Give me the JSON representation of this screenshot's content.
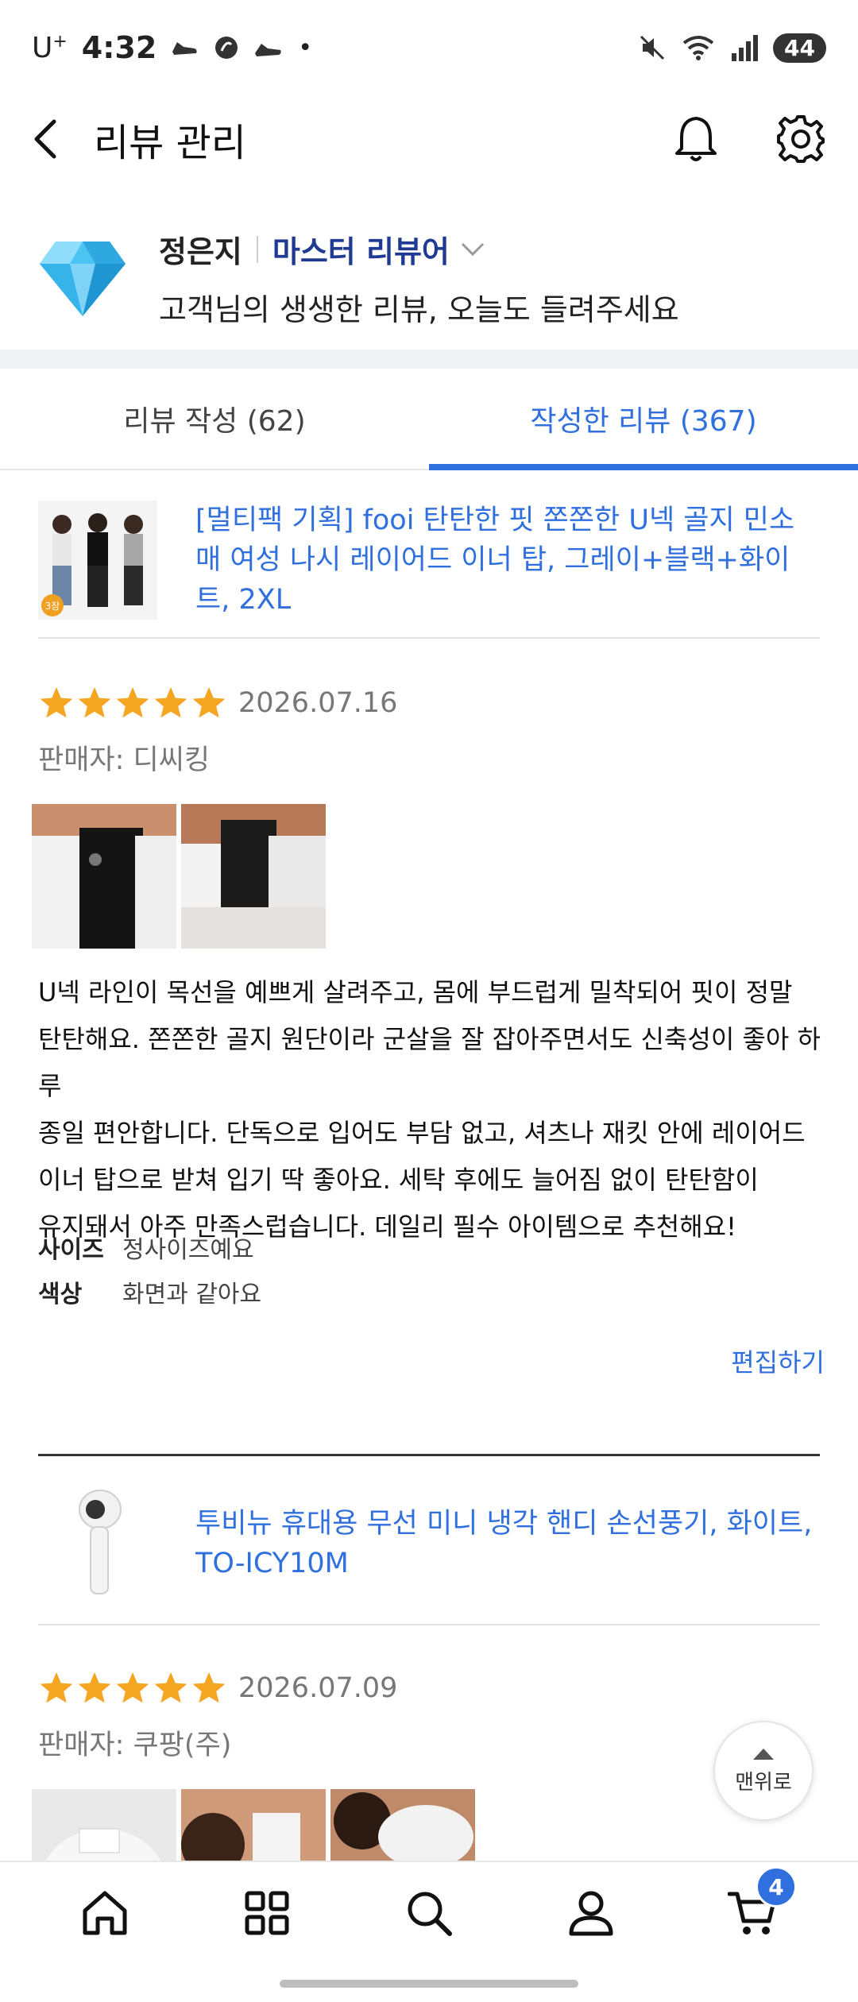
{
  "status_bar": {
    "carrier": "U",
    "carrier_sup": "+",
    "time": "4:32",
    "battery": "44"
  },
  "header": {
    "title": "리뷰 관리"
  },
  "profile": {
    "name": "정은지",
    "rank": "마스터 리뷰어",
    "subtitle": "고객님의 생생한 리뷰, 오늘도 들려주세요"
  },
  "tabs": [
    {
      "label": "리뷰 작성 (62)",
      "active": false
    },
    {
      "label": "작성한 리뷰 (367)",
      "active": true
    }
  ],
  "reviews": [
    {
      "product_name": "[멀티팩 기획] fooi 탄탄한 핏 쫀쫀한 U넥 골지 민소매 여성 나시 레이어드 이너 탑, 그레이+블랙+화이트, 2XL",
      "thumb_badge": "3장",
      "rating": 5,
      "date": "2026.07.16",
      "seller": "판매자: 디씨킹",
      "text_lines": [
        "U넥 라인이 목선을 예쁘게 살려주고, 몸에 부드럽게 밀착되어 핏이 정말",
        "탄탄해요. 쫀쫀한 골지 원단이라 군살을 잘 잡아주면서도 신축성이 좋아 하루",
        "종일 편안합니다. 단독으로 입어도 부담 없고, 셔츠나 재킷 안에 레이어드",
        "이너 탑으로 받쳐 입기 딱 좋아요. 세탁 후에도 늘어짐 없이 탄탄함이",
        "유지돼서 아주 만족스럽습니다. 데일리 필수 아이템으로 추천해요!"
      ],
      "meta": [
        {
          "label": "사이즈",
          "value": "정사이즈예요"
        },
        {
          "label": "색상",
          "value": "화면과 같아요"
        }
      ],
      "edit_label": "편집하기"
    },
    {
      "product_name": "투비뉴 휴대용 무선 미니 냉각 핸디 손선풍기, 화이트, TO-ICY10M",
      "rating": 5,
      "date": "2026.07.09",
      "seller": "판매자: 쿠팡(주)"
    }
  ],
  "scroll_top_label": "맨위로",
  "bottom_nav": {
    "cart_count": "4"
  },
  "colors": {
    "accent": "#2f6fde",
    "rank": "#1f3a93",
    "star": "#f5a623"
  }
}
